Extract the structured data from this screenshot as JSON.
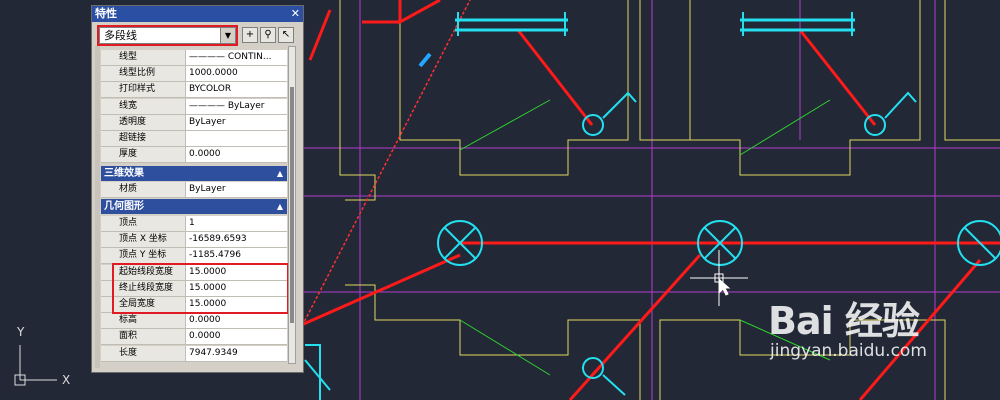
{
  "palette": {
    "title": "特性",
    "close_glyph": "✕",
    "object_type": "多段线",
    "buttons": [
      "select-objects-icon",
      "quick-select-icon",
      "toggle-pickadd-icon"
    ]
  },
  "general_rows": [
    {
      "label": "线型",
      "value": "———— CONTIN..."
    },
    {
      "label": "线型比例",
      "value": "1000.0000"
    },
    {
      "label": "打印样式",
      "value": "BYCOLOR"
    },
    {
      "label": "线宽",
      "value": "———— ByLayer"
    },
    {
      "label": "透明度",
      "value": "ByLayer"
    },
    {
      "label": "超链接",
      "value": ""
    },
    {
      "label": "厚度",
      "value": "0.0000"
    }
  ],
  "section_3d": {
    "title": "三维效果"
  },
  "rows_3d": [
    {
      "label": "材质",
      "value": "ByLayer"
    }
  ],
  "section_geom": {
    "title": "几何图形"
  },
  "geom_rows": [
    {
      "label": "顶点",
      "value": "1"
    },
    {
      "label": "顶点 X 坐标",
      "value": "-16589.6593"
    },
    {
      "label": "顶点 Y 坐标",
      "value": "-1185.4796"
    },
    {
      "label": "起始线段宽度",
      "value": "15.0000"
    },
    {
      "label": "终止线段宽度",
      "value": "15.0000"
    },
    {
      "label": "全局宽度",
      "value": "15.0000"
    },
    {
      "label": "标高",
      "value": "0.0000"
    },
    {
      "label": "面积",
      "value": "0.0000"
    },
    {
      "label": "长度",
      "value": "7947.9349"
    }
  ],
  "ucs": {
    "x_label": "X",
    "y_label": "Y"
  },
  "watermark": {
    "main": "Bai 经验",
    "url": "jingyan.baidu.com"
  },
  "colors": {
    "background": "#222836",
    "red": "#ff1a1a",
    "cyan": "#22e0f0",
    "yellow": "#e8e06a",
    "magenta": "#c040d0",
    "green": "#2fd12f"
  }
}
